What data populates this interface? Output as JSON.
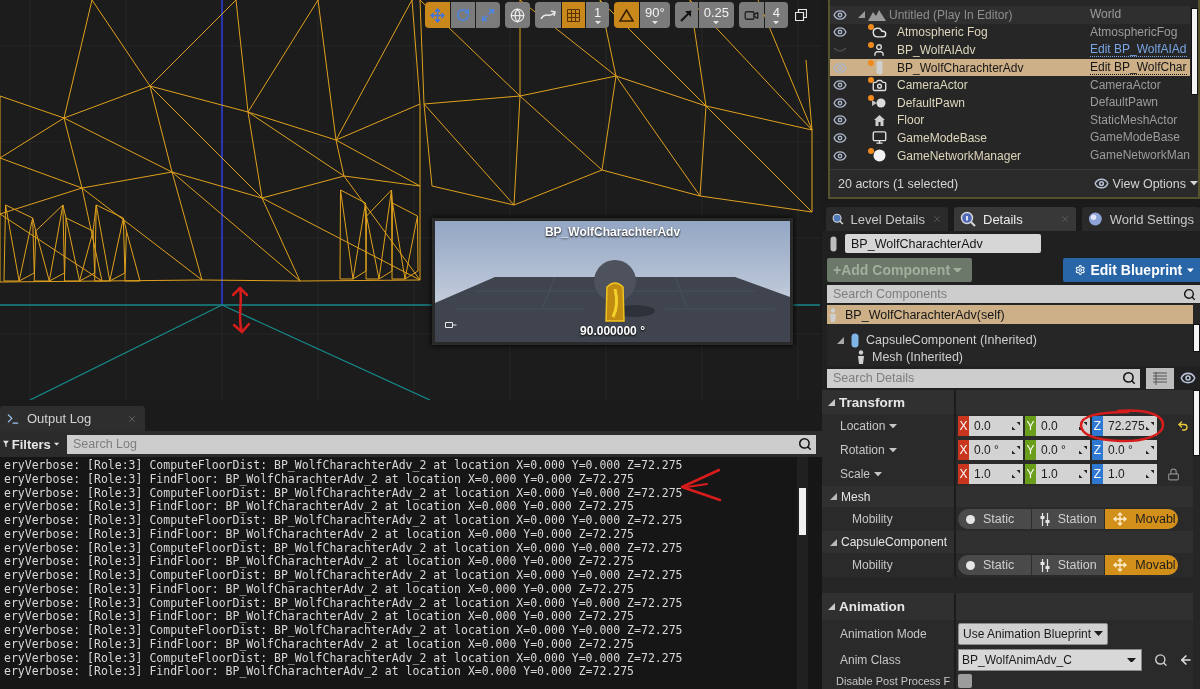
{
  "viewport": {
    "toolbar": [
      {
        "buttons": [
          {
            "kind": "icon",
            "on": true
          },
          {
            "kind": "icon",
            "on": false
          },
          {
            "kind": "icon",
            "on": false
          }
        ]
      },
      {
        "buttons": [
          {
            "kind": "icon",
            "on": false
          }
        ]
      },
      {
        "buttons": [
          {
            "kind": "icon",
            "on": false
          },
          {
            "kind": "icon",
            "on": true
          },
          {
            "kind": "value",
            "text": "1",
            "on": false
          }
        ]
      },
      {
        "buttons": [
          {
            "kind": "icon",
            "on": true
          },
          {
            "kind": "value",
            "text": "90°",
            "on": false
          }
        ]
      },
      {
        "buttons": [
          {
            "kind": "icon",
            "on": false
          },
          {
            "kind": "value",
            "text": "0.25",
            "on": false
          }
        ]
      },
      {
        "buttons": [
          {
            "kind": "icon",
            "on": false
          },
          {
            "kind": "value",
            "text": "4",
            "on": false
          }
        ]
      }
    ],
    "preview": {
      "title": "BP_WolfCharachterAdv",
      "angle": "90.000000 °"
    }
  },
  "output_log": {
    "tab": "Output Log",
    "filters": "Filters",
    "search": {
      "placeholder": "Search Log"
    },
    "lines": [
      "eryVerbose: [Role:3] ComputeFloorDist: BP_WolfCharachterAdv_2 at location X=0.000 Y=0.000 Z=72.275",
      "eryVerbose: [Role:3] FindFloor: BP_WolfCharachterAdv_2 at location X=0.000 Y=0.000 Z=72.275",
      "eryVerbose: [Role:3] ComputeFloorDist: BP_WolfCharachterAdv_2 at location X=0.000 Y=0.000 Z=72.275",
      "eryVerbose: [Role:3] FindFloor: BP_WolfCharachterAdv_2 at location X=0.000 Y=0.000 Z=72.275",
      "eryVerbose: [Role:3] ComputeFloorDist: BP_WolfCharachterAdv_2 at location X=0.000 Y=0.000 Z=72.275",
      "eryVerbose: [Role:3] FindFloor: BP_WolfCharachterAdv_2 at location X=0.000 Y=0.000 Z=72.275",
      "eryVerbose: [Role:3] ComputeFloorDist: BP_WolfCharachterAdv_2 at location X=0.000 Y=0.000 Z=72.275",
      "eryVerbose: [Role:3] FindFloor: BP_WolfCharachterAdv_2 at location X=0.000 Y=0.000 Z=72.275",
      "eryVerbose: [Role:3] ComputeFloorDist: BP_WolfCharachterAdv_2 at location X=0.000 Y=0.000 Z=72.275",
      "eryVerbose: [Role:3] FindFloor: BP_WolfCharachterAdv_2 at location X=0.000 Y=0.000 Z=72.275",
      "eryVerbose: [Role:3] ComputeFloorDist: BP_WolfCharachterAdv_2 at location X=0.000 Y=0.000 Z=72.275",
      "eryVerbose: [Role:3] FindFloor: BP_WolfCharachterAdv_2 at location X=0.000 Y=0.000 Z=72.275",
      "eryVerbose: [Role:3] ComputeFloorDist: BP_WolfCharachterAdv_2 at location X=0.000 Y=0.000 Z=72.275",
      "eryVerbose: [Role:3] FindFloor: BP_WolfCharachterAdv_2 at location X=0.000 Y=0.000 Z=72.275",
      "eryVerbose: [Role:3] ComputeFloorDist: BP_WolfCharachterAdv_2 at location X=0.000 Y=0.000 Z=72.275",
      "eryVerbose: [Role:3] FindFloor: BP_WolfCharachterAdv_2 at location X=0.000 Y=0.000 Z=72.275"
    ]
  },
  "outliner": {
    "rows": [
      {
        "kind": "world",
        "name": "Untitled (Play In Editor)",
        "type": "World",
        "type_link": false,
        "visible": true,
        "selected": false,
        "badge": false,
        "expanded": true,
        "children": [
          {
            "kind": "actor",
            "name": "Atmospheric Fog",
            "type": "AtmosphericFog",
            "type_link": false,
            "visible": true,
            "selected": false,
            "badge": true
          },
          {
            "kind": "actor",
            "name": "BP_WolfAIAdv",
            "type": "Edit BP_WolfAIAd",
            "type_link": true,
            "visible": false,
            "selected": false,
            "badge": true
          },
          {
            "kind": "actor",
            "name": "BP_WolfCharachterAdv",
            "type": "Edit BP_WolfChar",
            "type_link": true,
            "visible": true,
            "selected": true,
            "badge": true
          },
          {
            "kind": "actor",
            "name": "CameraActor",
            "type": "CameraActor",
            "type_link": false,
            "visible": true,
            "selected": false,
            "badge": true
          },
          {
            "kind": "actor",
            "name": "DefaultPawn",
            "type": "DefaultPawn",
            "type_link": false,
            "visible": true,
            "selected": false,
            "badge": true
          },
          {
            "kind": "actor",
            "name": "Floor",
            "type": "StaticMeshActor",
            "type_link": false,
            "visible": true,
            "selected": false,
            "badge": false
          },
          {
            "kind": "actor",
            "name": "GameModeBase",
            "type": "GameModeBase",
            "type_link": false,
            "visible": true,
            "selected": false,
            "badge": false
          },
          {
            "kind": "actor",
            "name": "GameNetworkManager",
            "type": "GameNetworkMan",
            "type_link": false,
            "visible": true,
            "selected": false,
            "badge": true
          }
        ]
      }
    ],
    "status": "20 actors (1 selected)",
    "view_options": "View Options"
  },
  "details": {
    "tabs": [
      {
        "label": "Level Details",
        "selected": false
      },
      {
        "label": "Details",
        "selected": true
      },
      {
        "label": "World Settings",
        "selected": false
      }
    ],
    "actor_name": "BP_WolfCharachterAdv",
    "add_component": {
      "label": "+Add Component",
      "disabled": true
    },
    "edit_blueprint": {
      "label": "Edit Blueprint"
    },
    "component_search": {
      "placeholder": "Search Components"
    },
    "components": [
      {
        "kind": "self",
        "name": "BP_WolfCharachterAdv(self)",
        "selected": true
      },
      {
        "kind": "component",
        "name": "CapsuleComponent (Inherited)",
        "selected": false,
        "expanded": true,
        "children": [
          {
            "kind": "component",
            "name": "Mesh (Inherited)",
            "selected": false
          }
        ]
      }
    ],
    "details_search": {
      "placeholder": "Search Details"
    },
    "categories": [
      {
        "title": "Transform",
        "expanded": true,
        "rows": [
          {
            "kind": "vector",
            "label": "Location",
            "modified": true,
            "values": [
              {
                "axis": "X",
                "value": "0.0",
                "color": "#c8361e"
              },
              {
                "axis": "Y",
                "value": "0.0",
                "color": "#6a9e1a"
              },
              {
                "axis": "Z",
                "value": "72.275",
                "color": "#2f78d2"
              }
            ]
          },
          {
            "kind": "vector",
            "label": "Rotation",
            "modified": false,
            "values": [
              {
                "axis": "X",
                "value": "0.0 °",
                "color": "#c8361e"
              },
              {
                "axis": "Y",
                "value": "0.0 °",
                "color": "#6a9e1a"
              },
              {
                "axis": "Z",
                "value": "0.0 °",
                "color": "#2f78d2"
              }
            ]
          },
          {
            "kind": "scale",
            "label": "Scale",
            "modified": false,
            "values": [
              {
                "axis": "X",
                "value": "1.0",
                "color": "#c8361e"
              },
              {
                "axis": "Y",
                "value": "1.0",
                "color": "#6a9e1a"
              },
              {
                "axis": "Z",
                "value": "1.0",
                "color": "#2f78d2"
              }
            ]
          }
        ],
        "subcategories": [
          {
            "title": "Mesh",
            "expanded": true,
            "rows": [
              {
                "kind": "mobility",
                "label": "Mobility",
                "options": [
                  {
                    "label": "Static",
                    "selected": false
                  },
                  {
                    "label": "Station",
                    "selected": false
                  },
                  {
                    "label": "Movabl",
                    "selected": true
                  }
                ]
              }
            ]
          },
          {
            "title": "CapsuleComponent",
            "expanded": true,
            "rows": [
              {
                "kind": "mobility",
                "label": "Mobility",
                "options": [
                  {
                    "label": "Static",
                    "selected": false
                  },
                  {
                    "label": "Station",
                    "selected": false
                  },
                  {
                    "label": "Movabl",
                    "selected": true
                  }
                ]
              }
            ]
          }
        ]
      },
      {
        "title": "Animation",
        "expanded": true,
        "rows": [
          {
            "kind": "dropdown",
            "label": "Animation Mode",
            "value": "Use Animation Blueprint"
          },
          {
            "kind": "asset",
            "label": "Anim Class",
            "value": "BP_WolfAnimAdv_C"
          },
          {
            "kind": "checkbox",
            "label": "Disable Post Process F",
            "checked": false
          }
        ]
      }
    ]
  }
}
